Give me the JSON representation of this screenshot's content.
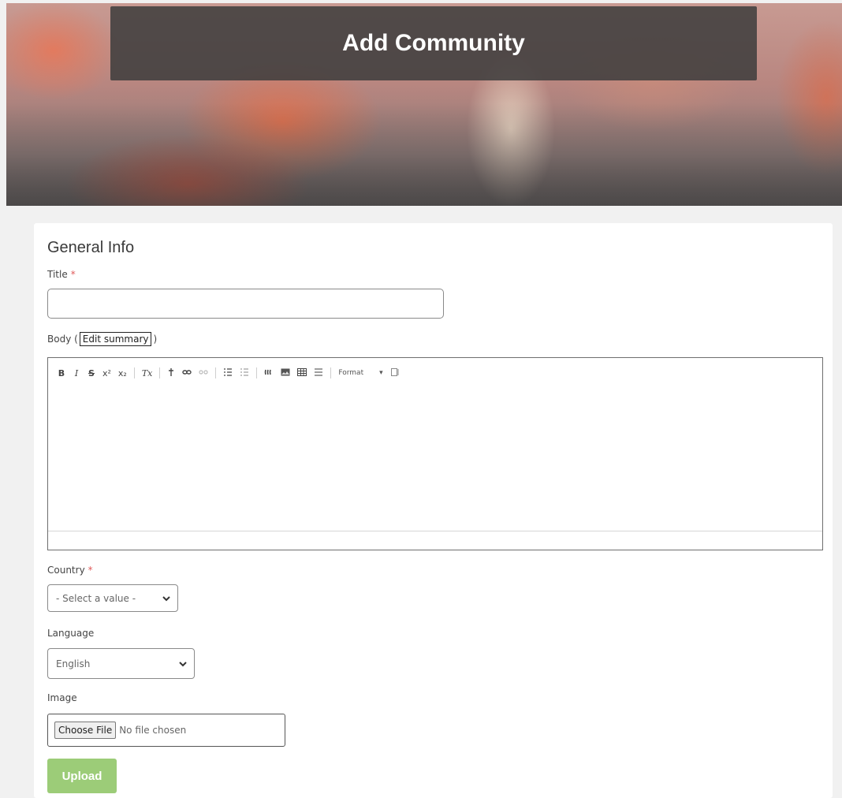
{
  "hero": {
    "title": "Add Community"
  },
  "form": {
    "section_title": "General Info",
    "title_label": "Title",
    "required_mark": "*",
    "body_label_prefix": "Body (",
    "edit_summary": "Edit summary",
    "body_label_suffix": ")",
    "toolbar": {
      "bold": "B",
      "italic": "I",
      "strike": "S",
      "superscript": "x²",
      "subscript": "x₂",
      "remove_format": "Tx",
      "format_label": "Format",
      "format_arrow": "▾"
    },
    "country_label": "Country",
    "country_value": "- Select a value -",
    "language_label": "Language",
    "language_value": "English",
    "image_label": "Image",
    "choose_file": "Choose File",
    "no_file": "No file chosen",
    "upload": "Upload"
  },
  "colors": {
    "upload_button": "#9ccc78",
    "required": "#e05a5a",
    "hero_title_bar": "#3c3c3c"
  }
}
